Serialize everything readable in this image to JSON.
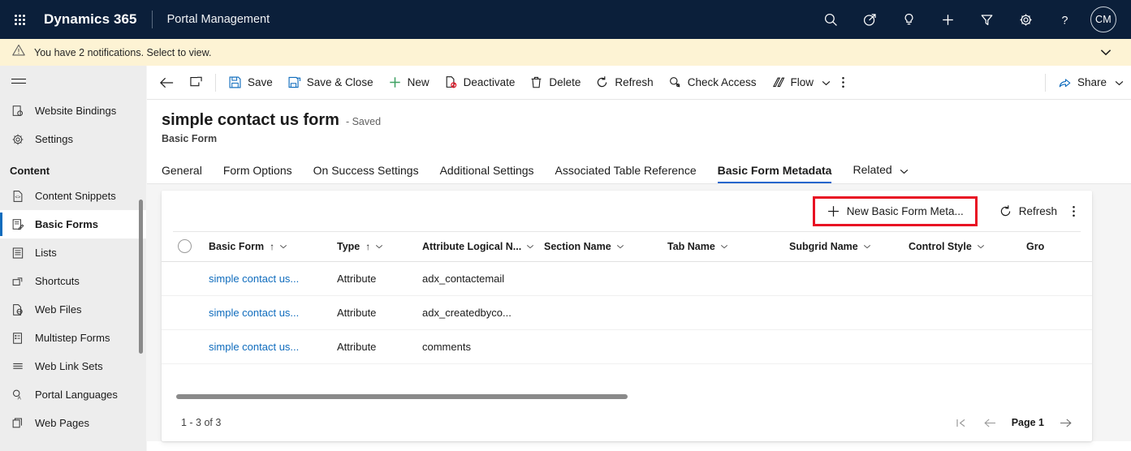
{
  "topnav": {
    "waffle_label": "app-launcher",
    "brand": "Dynamics 365",
    "app_name": "Portal Management",
    "icons": [
      {
        "name": "search-icon",
        "label": "Search"
      },
      {
        "name": "assistant-icon",
        "label": "Quick launch"
      },
      {
        "name": "lightbulb-icon",
        "label": "Insights"
      },
      {
        "name": "plus-icon",
        "label": "New"
      },
      {
        "name": "filter-icon",
        "label": "Filter"
      },
      {
        "name": "gear-icon",
        "label": "Settings"
      },
      {
        "name": "help-icon",
        "label": "Help"
      }
    ],
    "avatar_initials": "CM"
  },
  "notification": {
    "text": "You have 2 notifications. Select to view.",
    "icon": "warning-icon",
    "chevron": "chevron-down-icon",
    "background": "#fdf3d4"
  },
  "sidebar": {
    "hamburger": "hamburger-icon",
    "items": [
      {
        "label": "Website Bindings",
        "icon": "website-bindings-icon",
        "selected": false
      },
      {
        "label": "Settings",
        "icon": "gear-icon",
        "selected": false
      }
    ],
    "group_label": "Content",
    "content_items": [
      {
        "label": "Content Snippets",
        "icon": "content-snippet-icon",
        "selected": false
      },
      {
        "label": "Basic Forms",
        "icon": "basic-forms-icon",
        "selected": true
      },
      {
        "label": "Lists",
        "icon": "list-icon",
        "selected": false
      },
      {
        "label": "Shortcuts",
        "icon": "shortcut-icon",
        "selected": false
      },
      {
        "label": "Web Files",
        "icon": "web-file-icon",
        "selected": false
      },
      {
        "label": "Multistep Forms",
        "icon": "multistep-forms-icon",
        "selected": false
      },
      {
        "label": "Web Link Sets",
        "icon": "web-link-sets-icon",
        "selected": false
      },
      {
        "label": "Portal Languages",
        "icon": "portal-languages-icon",
        "selected": false
      },
      {
        "label": "Web Pages",
        "icon": "web-pages-icon",
        "selected": false
      }
    ]
  },
  "command_bar": {
    "back": "back-arrow-icon",
    "popout": "open-in-new-window-icon",
    "items": [
      {
        "label": "Save",
        "icon": "save-icon"
      },
      {
        "label": "Save & Close",
        "icon": "save-and-close-icon"
      },
      {
        "label": "New",
        "icon": "plus-icon"
      },
      {
        "label": "Deactivate",
        "icon": "deactivate-icon"
      },
      {
        "label": "Delete",
        "icon": "trash-icon"
      },
      {
        "label": "Refresh",
        "icon": "refresh-icon"
      },
      {
        "label": "Check Access",
        "icon": "check-access-icon"
      },
      {
        "label": "Flow",
        "icon": "flow-icon",
        "chevron": true
      }
    ],
    "overflow": "more-options-icon",
    "share_label": "Share",
    "share_icon": "share-icon"
  },
  "record": {
    "title": "simple contact us form",
    "saved_status": "- Saved",
    "entity": "Basic Form"
  },
  "tabs": [
    {
      "label": "General",
      "active": false
    },
    {
      "label": "Form Options",
      "active": false
    },
    {
      "label": "On Success Settings",
      "active": false
    },
    {
      "label": "Additional Settings",
      "active": false
    },
    {
      "label": "Associated Table Reference",
      "active": false
    },
    {
      "label": "Basic Form Metadata",
      "active": true
    },
    {
      "label": "Related",
      "active": false,
      "chevron": true
    }
  ],
  "grid": {
    "commands": {
      "new_label": "New Basic Form Meta...",
      "new_icon": "plus-icon",
      "new_highlight_color": "#e81123",
      "refresh_label": "Refresh",
      "refresh_icon": "refresh-icon",
      "overflow_icon": "more-options-icon"
    },
    "columns": [
      {
        "label": "Basic Form",
        "sorted": true,
        "sort_dir": "asc"
      },
      {
        "label": "Type",
        "sorted": true,
        "sort_dir": "asc"
      },
      {
        "label": "Attribute Logical N...",
        "sorted": false
      },
      {
        "label": "Section Name",
        "sorted": false
      },
      {
        "label": "Tab Name",
        "sorted": false
      },
      {
        "label": "Subgrid Name",
        "sorted": false
      },
      {
        "label": "Control Style",
        "sorted": false
      },
      {
        "label": "Gro",
        "sorted": false
      }
    ],
    "rows": [
      {
        "basic_form": "simple contact us...",
        "type": "Attribute",
        "attribute": "adx_contactemail",
        "section": "",
        "tab": "",
        "subgrid": "",
        "control_style": "",
        "gro": ""
      },
      {
        "basic_form": "simple contact us...",
        "type": "Attribute",
        "attribute": "adx_createdbyco...",
        "section": "",
        "tab": "",
        "subgrid": "",
        "control_style": "",
        "gro": ""
      },
      {
        "basic_form": "simple contact us...",
        "type": "Attribute",
        "attribute": "comments",
        "section": "",
        "tab": "",
        "subgrid": "",
        "control_style": "",
        "gro": ""
      }
    ],
    "footer": {
      "row_count": "1 - 3 of 3",
      "first_page_icon": "first-page-icon",
      "prev_page_icon": "previous-page-icon",
      "page_label": "Page 1",
      "next_page_icon": "next-page-icon"
    }
  }
}
